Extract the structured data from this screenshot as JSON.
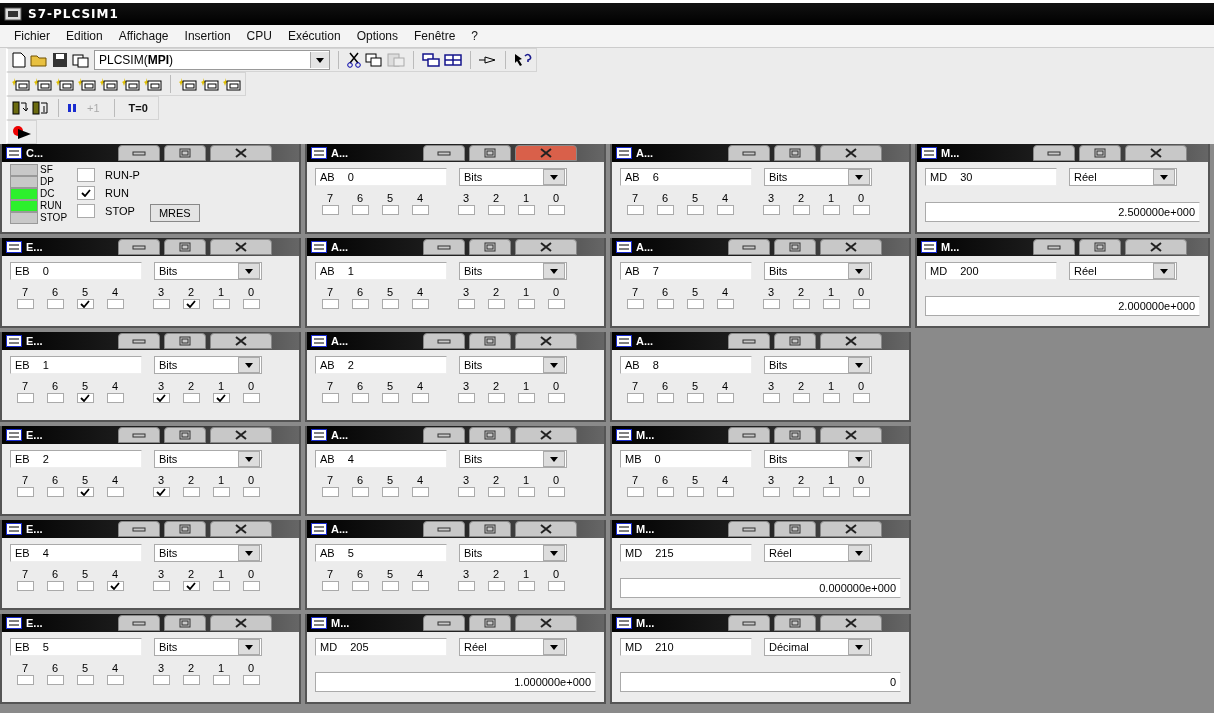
{
  "window": {
    "title": "S7-PLCSIM1"
  },
  "menu": [
    "Fichier",
    "Edition",
    "Affichage",
    "Insertion",
    "CPU",
    "Exécution",
    "Options",
    "Fenêtre",
    "?"
  ],
  "toolbar": {
    "connection": "PLCSIM(**MPI**)",
    "paste_disabled": true
  },
  "run_buttons": [
    {
      "label": "+1",
      "disabled": true
    },
    {
      "label": "T=0",
      "disabled": false
    }
  ],
  "columns": [
    {
      "windows": [
        {
          "kind": "cpu",
          "title": "C...",
          "active": false,
          "leds": [
            {
              "label": "SF",
              "on": false
            },
            {
              "label": "DP",
              "on": false
            },
            {
              "label": "DC",
              "on": true
            },
            {
              "label": "RUN",
              "on": true
            },
            {
              "label": "STOP",
              "on": false
            }
          ],
          "modes": [
            {
              "label": "RUN-P",
              "checked": false
            },
            {
              "label": "RUN",
              "checked": true
            },
            {
              "label": "STOP",
              "checked": false
            }
          ],
          "button": "MRES"
        },
        {
          "kind": "bits",
          "title": "E...",
          "active": false,
          "address": "EB 0",
          "format": "Bits",
          "bits": [
            {
              "label": "7",
              "checked": false
            },
            {
              "label": "6",
              "checked": false
            },
            {
              "label": "5",
              "checked": true
            },
            {
              "label": "4",
              "checked": false
            },
            {
              "label": "3",
              "checked": false
            },
            {
              "label": "2",
              "checked": true
            },
            {
              "label": "1",
              "checked": false
            },
            {
              "label": "0",
              "checked": false
            }
          ]
        },
        {
          "kind": "bits",
          "title": "E...",
          "active": false,
          "address": "EB 1",
          "format": "Bits",
          "bits": [
            {
              "label": "7",
              "checked": false
            },
            {
              "label": "6",
              "checked": false
            },
            {
              "label": "5",
              "checked": true
            },
            {
              "label": "4",
              "checked": false
            },
            {
              "label": "3",
              "checked": true
            },
            {
              "label": "2",
              "checked": false
            },
            {
              "label": "1",
              "checked": true
            },
            {
              "label": "0",
              "checked": false
            }
          ]
        },
        {
          "kind": "bits",
          "title": "E...",
          "active": false,
          "address": "EB 2",
          "format": "Bits",
          "bits": [
            {
              "label": "7",
              "checked": false
            },
            {
              "label": "6",
              "checked": false
            },
            {
              "label": "5",
              "checked": true
            },
            {
              "label": "4",
              "checked": false
            },
            {
              "label": "3",
              "checked": true
            },
            {
              "label": "2",
              "checked": false
            },
            {
              "label": "1",
              "checked": false
            },
            {
              "label": "0",
              "checked": false
            }
          ]
        },
        {
          "kind": "bits",
          "title": "E...",
          "active": false,
          "address": "EB 4",
          "format": "Bits",
          "bits": [
            {
              "label": "7",
              "checked": false
            },
            {
              "label": "6",
              "checked": false
            },
            {
              "label": "5",
              "checked": false
            },
            {
              "label": "4",
              "checked": true
            },
            {
              "label": "3",
              "checked": false
            },
            {
              "label": "2",
              "checked": true
            },
            {
              "label": "1",
              "checked": false
            },
            {
              "label": "0",
              "checked": false
            }
          ]
        },
        {
          "kind": "bits",
          "title": "E...",
          "active": false,
          "address": "EB 5",
          "format": "Bits",
          "bits": [
            {
              "label": "7",
              "checked": false
            },
            {
              "label": "6",
              "checked": false
            },
            {
              "label": "5",
              "checked": false
            },
            {
              "label": "4",
              "checked": false
            },
            {
              "label": "3",
              "checked": false
            },
            {
              "label": "2",
              "checked": false
            },
            {
              "label": "1",
              "checked": false
            },
            {
              "label": "0",
              "checked": false
            }
          ]
        }
      ]
    },
    {
      "windows": [
        {
          "kind": "bits",
          "title": "A...",
          "active": true,
          "address": "AB 0",
          "format": "Bits",
          "bits": [
            {
              "label": "7",
              "checked": false
            },
            {
              "label": "6",
              "checked": false
            },
            {
              "label": "5",
              "checked": false
            },
            {
              "label": "4",
              "checked": false
            },
            {
              "label": "3",
              "checked": false
            },
            {
              "label": "2",
              "checked": false
            },
            {
              "label": "1",
              "checked": false
            },
            {
              "label": "0",
              "checked": false
            }
          ]
        },
        {
          "kind": "bits",
          "title": "A...",
          "active": false,
          "address": "AB 1",
          "format": "Bits",
          "bits": [
            {
              "label": "7",
              "checked": false
            },
            {
              "label": "6",
              "checked": false
            },
            {
              "label": "5",
              "checked": false
            },
            {
              "label": "4",
              "checked": false
            },
            {
              "label": "3",
              "checked": false
            },
            {
              "label": "2",
              "checked": false
            },
            {
              "label": "1",
              "checked": false
            },
            {
              "label": "0",
              "checked": false
            }
          ]
        },
        {
          "kind": "bits",
          "title": "A...",
          "active": false,
          "address": "AB 2",
          "format": "Bits",
          "bits": [
            {
              "label": "7",
              "checked": false
            },
            {
              "label": "6",
              "checked": false
            },
            {
              "label": "5",
              "checked": false
            },
            {
              "label": "4",
              "checked": false
            },
            {
              "label": "3",
              "checked": false
            },
            {
              "label": "2",
              "checked": false
            },
            {
              "label": "1",
              "checked": false
            },
            {
              "label": "0",
              "checked": false
            }
          ]
        },
        {
          "kind": "bits",
          "title": "A...",
          "active": false,
          "address": "AB 4",
          "format": "Bits",
          "bits": [
            {
              "label": "7",
              "checked": false
            },
            {
              "label": "6",
              "checked": false
            },
            {
              "label": "5",
              "checked": false
            },
            {
              "label": "4",
              "checked": false
            },
            {
              "label": "3",
              "checked": false
            },
            {
              "label": "2",
              "checked": false
            },
            {
              "label": "1",
              "checked": false
            },
            {
              "label": "0",
              "checked": false
            }
          ]
        },
        {
          "kind": "bits",
          "title": "A...",
          "active": false,
          "address": "AB 5",
          "format": "Bits",
          "bits": [
            {
              "label": "7",
              "checked": false
            },
            {
              "label": "6",
              "checked": false
            },
            {
              "label": "5",
              "checked": false
            },
            {
              "label": "4",
              "checked": false
            },
            {
              "label": "3",
              "checked": false
            },
            {
              "label": "2",
              "checked": false
            },
            {
              "label": "1",
              "checked": false
            },
            {
              "label": "0",
              "checked": false
            }
          ]
        },
        {
          "kind": "value",
          "title": "M...",
          "active": false,
          "address": "MD 205",
          "format": "Réel",
          "value": "1.000000e+000"
        }
      ]
    },
    {
      "windows": [
        {
          "kind": "bits",
          "title": "A...",
          "active": false,
          "address": "AB 6",
          "format": "Bits",
          "bits": [
            {
              "label": "7",
              "checked": false
            },
            {
              "label": "6",
              "checked": false
            },
            {
              "label": "5",
              "checked": false
            },
            {
              "label": "4",
              "checked": false
            },
            {
              "label": "3",
              "checked": false
            },
            {
              "label": "2",
              "checked": false
            },
            {
              "label": "1",
              "checked": false
            },
            {
              "label": "0",
              "checked": false
            }
          ]
        },
        {
          "kind": "bits",
          "title": "A...",
          "active": false,
          "address": "AB 7",
          "format": "Bits",
          "bits": [
            {
              "label": "7",
              "checked": false
            },
            {
              "label": "6",
              "checked": false
            },
            {
              "label": "5",
              "checked": false
            },
            {
              "label": "4",
              "checked": false
            },
            {
              "label": "3",
              "checked": false
            },
            {
              "label": "2",
              "checked": false
            },
            {
              "label": "1",
              "checked": false
            },
            {
              "label": "0",
              "checked": false
            }
          ]
        },
        {
          "kind": "bits",
          "title": "A...",
          "active": false,
          "address": "AB 8",
          "format": "Bits",
          "bits": [
            {
              "label": "7",
              "checked": false
            },
            {
              "label": "6",
              "checked": false
            },
            {
              "label": "5",
              "checked": false
            },
            {
              "label": "4",
              "checked": false
            },
            {
              "label": "3",
              "checked": false
            },
            {
              "label": "2",
              "checked": false
            },
            {
              "label": "1",
              "checked": false
            },
            {
              "label": "0",
              "checked": false
            }
          ]
        },
        {
          "kind": "bits",
          "title": "M...",
          "active": false,
          "address": "MB 0",
          "format": "Bits",
          "bits": [
            {
              "label": "7",
              "checked": false
            },
            {
              "label": "6",
              "checked": false
            },
            {
              "label": "5",
              "checked": false
            },
            {
              "label": "4",
              "checked": false
            },
            {
              "label": "3",
              "checked": false
            },
            {
              "label": "2",
              "checked": false
            },
            {
              "label": "1",
              "checked": false
            },
            {
              "label": "0",
              "checked": false
            }
          ]
        },
        {
          "kind": "value",
          "title": "M...",
          "active": false,
          "address": "MD 215",
          "format": "Réel",
          "value": "0.000000e+000"
        },
        {
          "kind": "value",
          "title": "M...",
          "active": false,
          "address": "MD 210",
          "format": "Décimal",
          "value": "0"
        }
      ]
    },
    {
      "windows": [
        {
          "kind": "value",
          "title": "M...",
          "active": false,
          "address": "MD 30",
          "format": "Réel",
          "value": "2.500000e+000"
        },
        {
          "kind": "value",
          "title": "M...",
          "active": false,
          "address": "MD 200",
          "format": "Réel",
          "value": "2.000000e+000"
        }
      ]
    }
  ]
}
